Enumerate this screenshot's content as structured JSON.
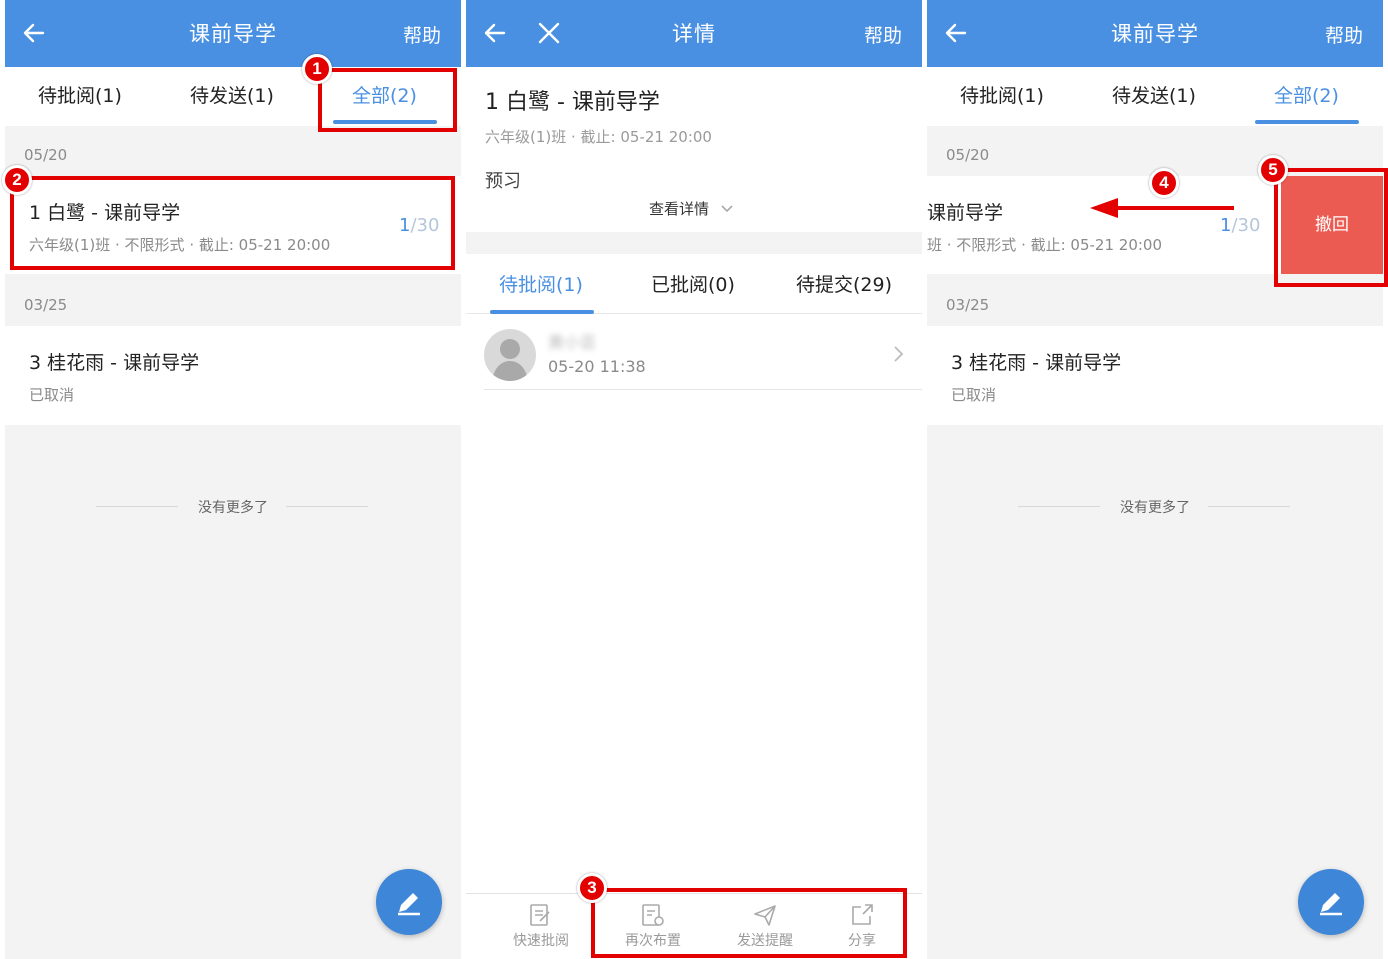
{
  "panel1": {
    "header": {
      "title": "课前导学",
      "help": "帮助"
    },
    "tabs": [
      "待批阅(1)",
      "待发送(1)",
      "全部(2)"
    ],
    "groups": [
      {
        "date": "05/20",
        "title": "1 白鹭 - 课前导学",
        "subtitle": "六年级(1)班 · 不限形式 · 截止: 05-21 20:00",
        "count_done": "1",
        "count_total": "/30"
      },
      {
        "date": "03/25",
        "title": "3 桂花雨 - 课前导学",
        "subtitle": "已取消"
      }
    ],
    "no_more": "没有更多了"
  },
  "panel2": {
    "header": {
      "title": "详情",
      "help": "帮助"
    },
    "assignment_title": "1 白鹭 - 课前导学",
    "assignment_sub": "六年级(1)班 · 截止: 05-21 20:00",
    "type_label": "预习",
    "view_details": "查看详情",
    "tabs": [
      "待批阅(1)",
      "已批阅(0)",
      "待提交(29)"
    ],
    "student": {
      "name": "黄小芸",
      "time": "05-20 11:38"
    },
    "bottom_actions": [
      "快速批阅",
      "再次布置",
      "发送提醒",
      "分享"
    ]
  },
  "panel3": {
    "header": {
      "title": "课前导学",
      "help": "帮助"
    },
    "tabs": [
      "待批阅(1)",
      "待发送(1)",
      "全部(2)"
    ],
    "groups": [
      {
        "date": "05/20",
        "title": "课前导学",
        "subtitle": "班 · 不限形式 · 截止: 05-21 20:00",
        "count_done": "1",
        "count_total": "/30"
      },
      {
        "date": "03/25",
        "title": "3 桂花雨 - 课前导学",
        "subtitle": "已取消"
      }
    ],
    "revoke_label": "撤回",
    "no_more": "没有更多了"
  },
  "annotations": [
    "1",
    "2",
    "3",
    "4",
    "5"
  ],
  "colors": {
    "header": "#4a90e2",
    "accent": "#4a90e2",
    "highlight": "#e30000",
    "revoke": "#ec5b52",
    "fab": "#3d86d8"
  },
  "icons": {
    "back": "arrow-left-icon",
    "close": "close-icon",
    "fab": "pencil-icon",
    "chevron": "chevron-right-icon"
  }
}
